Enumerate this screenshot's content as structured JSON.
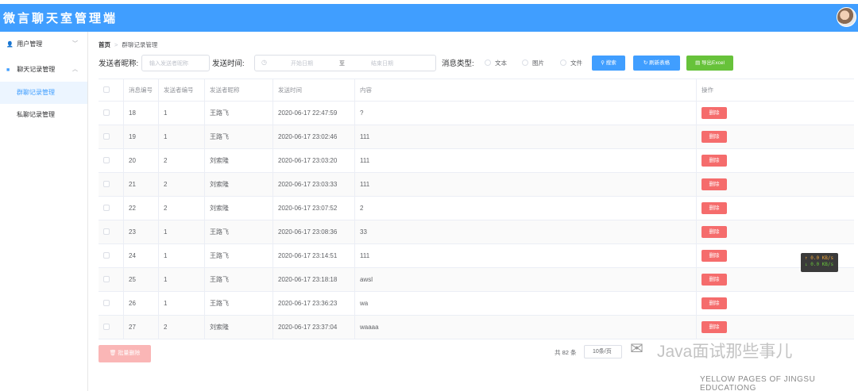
{
  "header": {
    "title": "微言聊天室管理端"
  },
  "sidebar": {
    "items": [
      {
        "label": "用户管理",
        "icon": "user-icon",
        "chevron": "﹀"
      },
      {
        "label": "聊天记录管理",
        "icon": "book-icon",
        "chevron": "︿",
        "children": [
          {
            "label": "群聊记录管理",
            "active": true
          },
          {
            "label": "私聊记录管理",
            "active": false
          }
        ]
      }
    ]
  },
  "breadcrumb": {
    "home": "首页",
    "separator": ">",
    "current": "群聊记录管理"
  },
  "filter": {
    "nickname_label": "发送者昵称:",
    "nickname_placeholder": "输入发送者昵称",
    "time_label": "发送时间:",
    "start_placeholder": "开始日期",
    "range_separator": "至",
    "end_placeholder": "结束日期",
    "type_label": "消息类型:",
    "types": [
      "文本",
      "图片",
      "文件"
    ],
    "search_button": "搜索",
    "refresh_button": "刷新表格",
    "export_button": "导出Excel"
  },
  "table": {
    "columns": [
      "消息编号",
      "发送者编号",
      "发送者昵称",
      "发送时间",
      "内容",
      "操作"
    ],
    "delete_label": "删除",
    "rows": [
      {
        "id": "18",
        "sender_id": "1",
        "nickname": "王路飞",
        "time": "2020-06-17 22:47:59",
        "content": "?"
      },
      {
        "id": "19",
        "sender_id": "1",
        "nickname": "王路飞",
        "time": "2020-06-17 23:02:46",
        "content": "111"
      },
      {
        "id": "20",
        "sender_id": "2",
        "nickname": "刘索隆",
        "time": "2020-06-17 23:03:20",
        "content": "111"
      },
      {
        "id": "21",
        "sender_id": "2",
        "nickname": "刘索隆",
        "time": "2020-06-17 23:03:33",
        "content": "111"
      },
      {
        "id": "22",
        "sender_id": "2",
        "nickname": "刘索隆",
        "time": "2020-06-17 23:07:52",
        "content": "2"
      },
      {
        "id": "23",
        "sender_id": "1",
        "nickname": "王路飞",
        "time": "2020-06-17 23:08:36",
        "content": "33"
      },
      {
        "id": "24",
        "sender_id": "1",
        "nickname": "王路飞",
        "time": "2020-06-17 23:14:51",
        "content": "111"
      },
      {
        "id": "25",
        "sender_id": "1",
        "nickname": "王路飞",
        "time": "2020-06-17 23:18:18",
        "content": "awsl"
      },
      {
        "id": "26",
        "sender_id": "1",
        "nickname": "王路飞",
        "time": "2020-06-17 23:36:23",
        "content": "wa"
      },
      {
        "id": "27",
        "sender_id": "2",
        "nickname": "刘索隆",
        "time": "2020-06-17 23:37:04",
        "content": "waaaa"
      }
    ]
  },
  "footer": {
    "batch_delete": "批量删除",
    "total": "共 82 条",
    "page_size": "10条/页"
  },
  "speed_widget": {
    "up": "↑ 0.0 KB/s",
    "down": "↓ 0.0 KB/s"
  },
  "watermark": {
    "title": "Java面试那些事儿",
    "subtitle": "YELLOW PAGES OF JINGSU EDUCATIONG"
  },
  "colors": {
    "primary": "#409eff",
    "success": "#67c23a",
    "danger": "#f56c6c",
    "danger_light": "#fab6b6"
  }
}
